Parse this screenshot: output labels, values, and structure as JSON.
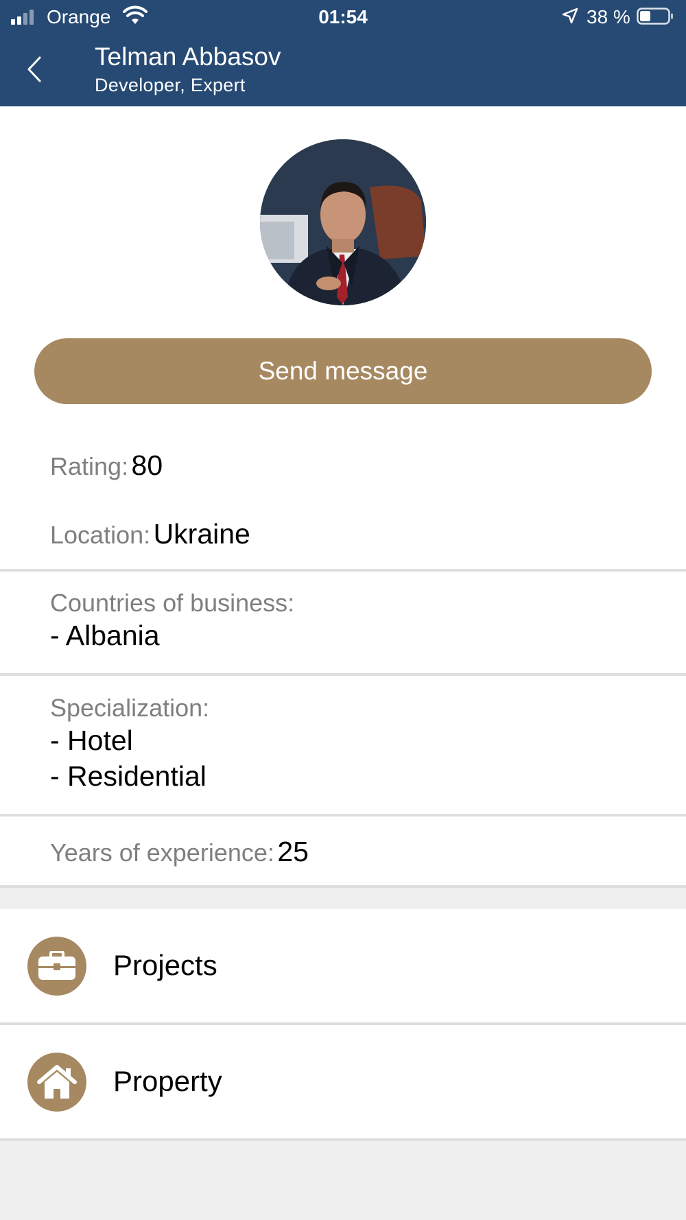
{
  "status_bar": {
    "carrier": "Orange",
    "time": "01:54",
    "battery": "38 %"
  },
  "header": {
    "title": "Telman Abbasov",
    "subtitle": "Developer, Expert"
  },
  "profile": {
    "send_message_label": "Send message",
    "rating_label": "Rating:",
    "rating_value": "80",
    "location_label": "Location:",
    "location_value": "Ukraine",
    "countries_label": "Countries of business:",
    "countries": [
      "- Albania"
    ],
    "specialization_label": "Specialization:",
    "specializations": [
      "- Hotel",
      "- Residential"
    ],
    "experience_label": "Years of experience:",
    "experience_value": "25"
  },
  "menu": [
    {
      "label": "Projects",
      "icon": "briefcase-icon"
    },
    {
      "label": "Property",
      "icon": "home-icon"
    }
  ],
  "colors": {
    "header_bg": "#264a73",
    "accent": "#a68961",
    "page_bg": "#efefef"
  }
}
